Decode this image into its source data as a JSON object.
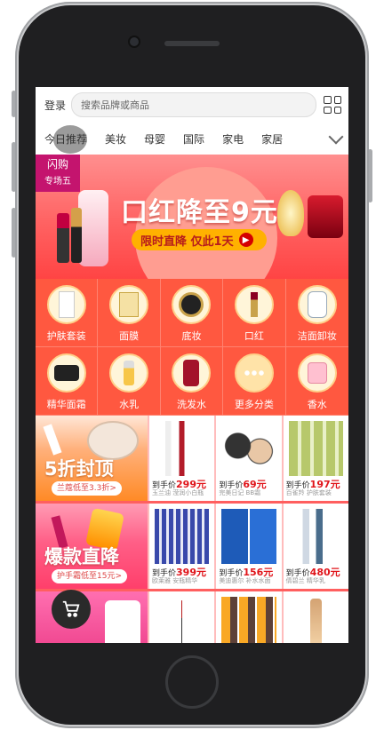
{
  "header": {
    "login": "登录",
    "search_placeholder": "搜索品牌或商品"
  },
  "tabs": [
    "今日推荐",
    "美妆",
    "母婴",
    "国际",
    "家电",
    "家居"
  ],
  "banner": {
    "tag_line1": "闪购",
    "tag_line2": "专场五",
    "title": "口红降至9元",
    "subtitle": "限时直降 仅此1天"
  },
  "categories": [
    {
      "label": "护肤套装",
      "icon": "skincare-set-icon"
    },
    {
      "label": "面膜",
      "icon": "face-mask-icon"
    },
    {
      "label": "底妆",
      "icon": "cushion-compact-icon"
    },
    {
      "label": "口红",
      "icon": "lipstick-icon"
    },
    {
      "label": "洁面卸妆",
      "icon": "cleanser-icon"
    },
    {
      "label": "精华面霜",
      "icon": "cream-jar-icon"
    },
    {
      "label": "水乳",
      "icon": "toner-icon"
    },
    {
      "label": "洗发水",
      "icon": "shampoo-icon"
    },
    {
      "label": "更多分类",
      "icon": "more-icon"
    },
    {
      "label": "香水",
      "icon": "perfume-icon"
    }
  ],
  "promos": [
    {
      "title": "5折封顶",
      "subtitle": "兰蔻低至3.3折>",
      "products": [
        {
          "price_prefix": "到手价",
          "price": "299元",
          "desc": "玉兰油 滢润小白瓶"
        },
        {
          "price_prefix": "到手价",
          "price": "69元",
          "desc": "完美日记 BB霜"
        },
        {
          "price_prefix": "到手价",
          "price": "197元",
          "desc": "百雀羚 护肤套装"
        }
      ]
    },
    {
      "title": "爆款直降",
      "subtitle": "护手霜低至15元>",
      "products": [
        {
          "price_prefix": "到手价",
          "price": "399元",
          "desc": "欧莱雅 安瓶精华"
        },
        {
          "price_prefix": "到手价",
          "price": "156元",
          "desc": "美迪惠尔 补水水面"
        },
        {
          "price_prefix": "到手价",
          "price": "480元",
          "desc": "倩碧兰 精华乳"
        }
      ]
    }
  ],
  "colors": {
    "accent": "#ff5840",
    "price": "#e0141a",
    "pill": "#ffb100"
  }
}
